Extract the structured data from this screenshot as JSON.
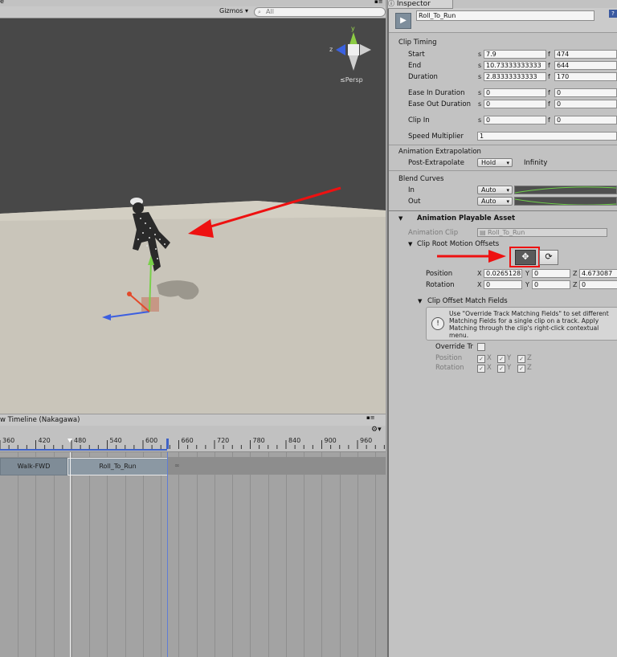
{
  "scene": {
    "top_label": "e",
    "gizmos_label": "Gizmos",
    "search_placeholder": "All",
    "persp_label": "Persp",
    "axis_y": "y",
    "axis_z": "z"
  },
  "timeline": {
    "title": "w Timeline (Nakagawa)",
    "ticks": [
      "360",
      "420",
      "480",
      "540",
      "600",
      "660",
      "720",
      "780",
      "840",
      "900",
      "960"
    ],
    "clips": [
      "Walk-FWD",
      "Roll_To_Run"
    ]
  },
  "inspector": {
    "tab_label": "Inspector",
    "object_name": "Roll_To_Run",
    "clip_timing": {
      "title": "Clip Timing",
      "rows": [
        {
          "label": "Start",
          "s": "7.9",
          "f": "474"
        },
        {
          "label": "End",
          "s": "10.73333333333",
          "f": "644"
        },
        {
          "label": "Duration",
          "s": "2.83333333333",
          "f": "170"
        },
        {
          "label": "Ease In Duration",
          "s": "0",
          "f": "0"
        },
        {
          "label": "Ease Out Duration",
          "s": "0",
          "f": "0"
        },
        {
          "label": "Clip In",
          "s": "0",
          "f": "0"
        }
      ],
      "s_unit": "s",
      "f_unit": "f",
      "speed_label": "Speed Multiplier",
      "speed_value": "1"
    },
    "extrapolation": {
      "title": "Animation Extrapolation",
      "post_label": "Post-Extrapolate",
      "post_value": "Hold",
      "post_extra": "Infinity"
    },
    "blend": {
      "title": "Blend Curves",
      "in_label": "In",
      "in_value": "Auto",
      "out_label": "Out",
      "out_value": "Auto"
    },
    "asset": {
      "title": "Animation Playable Asset",
      "clip_label": "Animation Clip",
      "clip_value": "Roll_To_Run",
      "offsets_title": "Clip Root Motion Offsets",
      "position_label": "Position",
      "rotation_label": "Rotation",
      "pos": {
        "x": "0.0265128",
        "y": "0",
        "z": "4.673087"
      },
      "rot": {
        "x": "0",
        "y": "0",
        "z": "0"
      },
      "axis_x": "X",
      "axis_y": "Y",
      "axis_z": "Z",
      "match_title": "Clip Offset Match Fields",
      "help_text": "Use \"Override Track Matching Fields\" to set different Matching Fields for a single clip on a track. Apply Matching through the clip's right-click contextual menu.",
      "override_label": "Override Tr",
      "match_position": "Position",
      "match_rotation": "Rotation"
    }
  },
  "colors": {
    "annotation_red": "#ee1111",
    "timeline_blue": "#3f62c6"
  }
}
